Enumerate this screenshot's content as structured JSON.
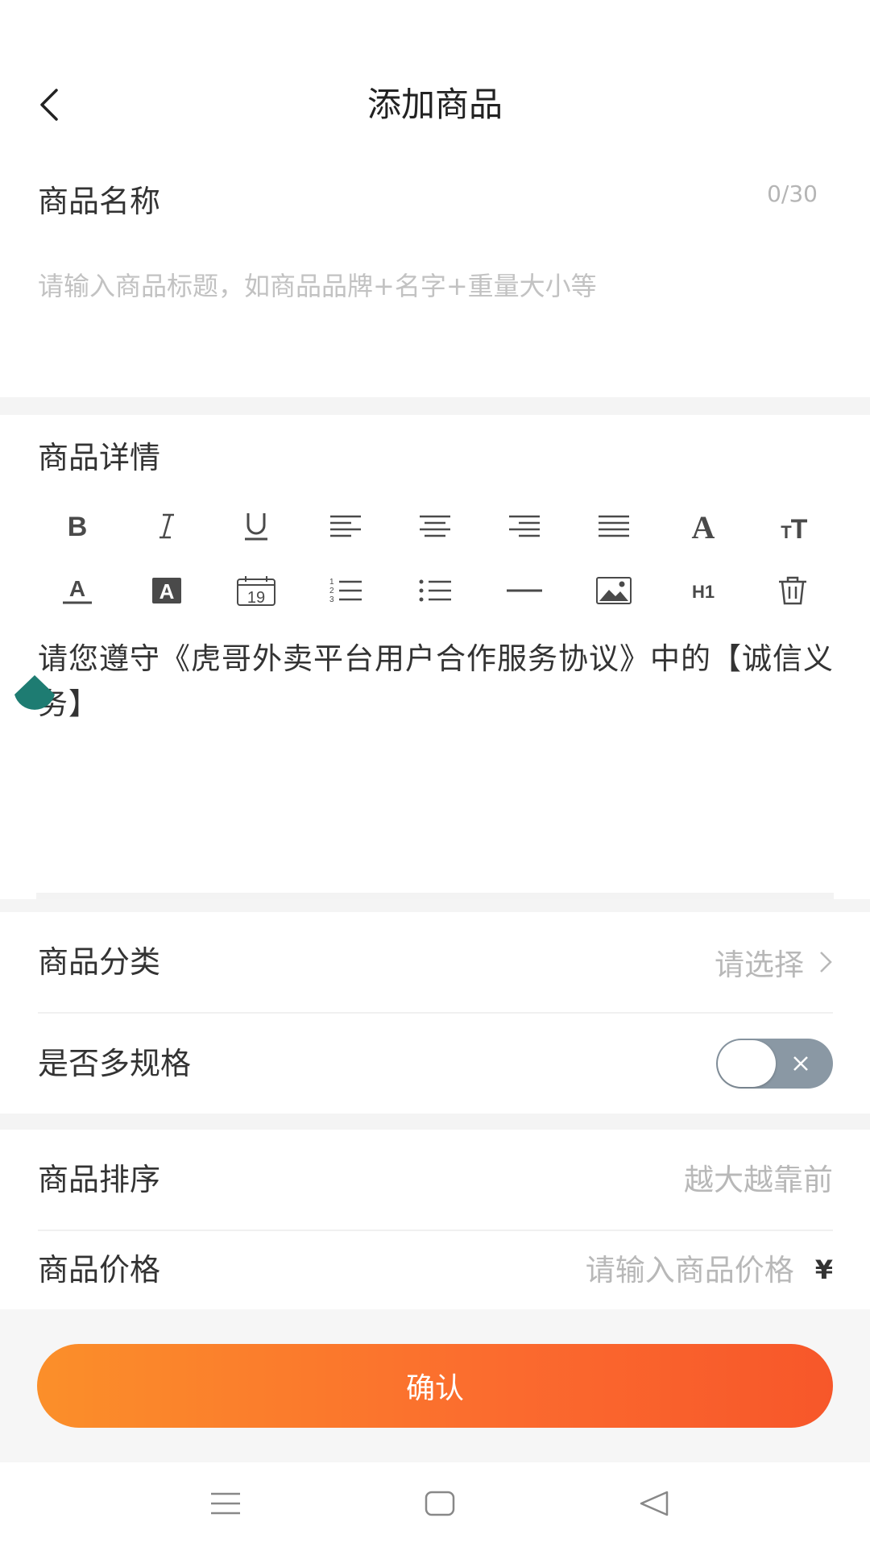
{
  "header": {
    "title": "添加商品"
  },
  "name_section": {
    "label": "商品名称",
    "counter": "0/30",
    "placeholder": "请输入商品标题，如商品品牌+名字+重量大小等",
    "value": ""
  },
  "details_section": {
    "label": "商品详情",
    "toolbar_row1": [
      "bold-icon",
      "italic-icon",
      "underline-icon",
      "align-left-icon",
      "align-center-icon",
      "align-right-icon",
      "align-justify-icon",
      "font-icon",
      "font-size-icon"
    ],
    "toolbar_row2": [
      "font-color-icon",
      "background-color-icon",
      "date-icon",
      "ordered-list-icon",
      "unordered-list-icon",
      "horizontal-rule-icon",
      "image-icon",
      "heading-1-icon",
      "delete-icon"
    ],
    "date_icon_text": "19",
    "heading_icon_text": "H1",
    "editor_text": "请您遵守《虎哥外卖平台用户合作服务协议》中的【诚信义务】"
  },
  "category_row": {
    "label": "商品分类",
    "value": "请选择"
  },
  "multi_spec_row": {
    "label": "是否多规格",
    "toggle_on": false
  },
  "sort_row": {
    "label": "商品排序",
    "placeholder": "越大越靠前"
  },
  "price_row": {
    "label": "商品价格",
    "placeholder": "请输入商品价格",
    "currency": "¥"
  },
  "confirm_button": {
    "label": "确认"
  },
  "system_nav": [
    "menu-icon",
    "home-icon",
    "back-triangle-icon"
  ],
  "colors": {
    "accent_start": "#fb8f2a",
    "accent_end": "#f7572a",
    "toggle_off": "#8a98a4",
    "cursor_handle": "#1e7c72"
  }
}
